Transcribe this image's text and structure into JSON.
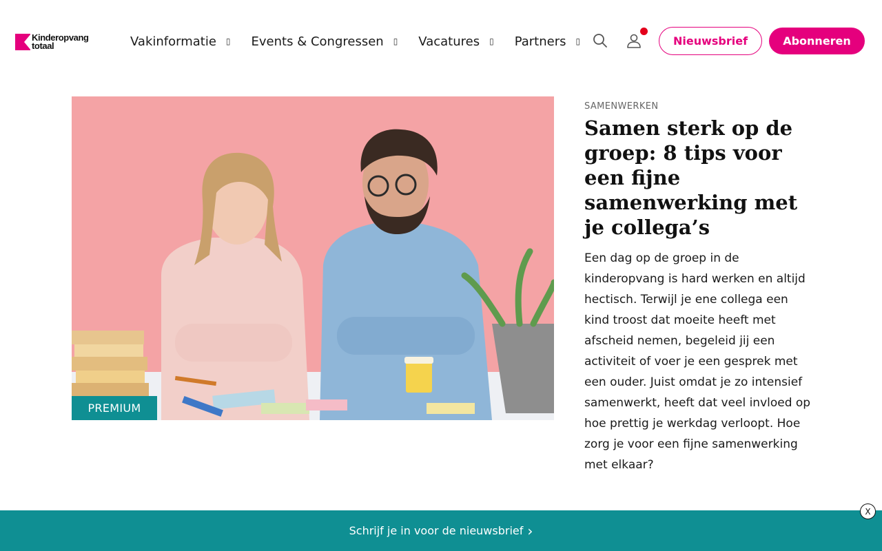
{
  "header": {
    "logo_line1": "Kinderopvang",
    "logo_line2": "totaal",
    "nav": [
      {
        "label": "Vakinformatie",
        "icon": "chevron-down-icon"
      },
      {
        "label": "Events & Congressen",
        "icon": "chevron-down-icon"
      },
      {
        "label": "Vacatures",
        "icon": "chevron-down-icon"
      },
      {
        "label": "Partners",
        "icon": "chevron-down-icon"
      }
    ],
    "chevron_glyph": "▯",
    "newsletter_button": "Nieuwsbrief",
    "subscribe_button": "Abonneren",
    "notification_active": true
  },
  "article": {
    "badge": "PREMIUM",
    "category": "SAMENWERKEN",
    "title": "Samen sterk op de groep: 8 tips voor een fijne samenwerking met je collega’s",
    "summary": "Een dag op de groep in de kinderopvang is hard werken en altijd hectisch. Terwijl je ene collega een kind troost dat moeite heeft met afscheid nemen, begeleid jij een activiteit of voer je een gesprek met een ouder. Juist omdat je zo intensief samenwerkt, heeft dat veel invloed op hoe prettig je werkdag verloopt. Hoe zorg je voor een fijne samenwerking met elkaar?"
  },
  "newsletter_bar": {
    "text": "Schrijf je in voor de nieuwsbrief",
    "arrow": "›",
    "close_label": "X"
  },
  "colors": {
    "brand_pink": "#e5007d",
    "teal": "#0f8f93",
    "notification_red": "#e3001b"
  }
}
